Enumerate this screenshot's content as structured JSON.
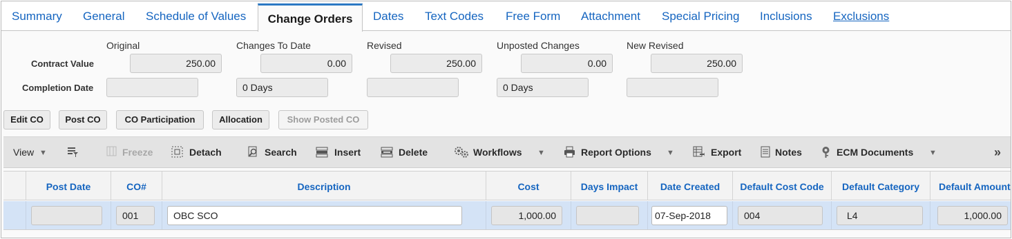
{
  "tabs": [
    {
      "label": "Summary"
    },
    {
      "label": "General"
    },
    {
      "label": "Schedule of Values"
    },
    {
      "label": "Change Orders"
    },
    {
      "label": "Dates"
    },
    {
      "label": "Text Codes"
    },
    {
      "label": "Free Form"
    },
    {
      "label": "Attachment"
    },
    {
      "label": "Special Pricing"
    },
    {
      "label": "Inclusions"
    },
    {
      "label": "Exclusions"
    }
  ],
  "active_tab": "Change Orders",
  "summary": {
    "columns": [
      "Original",
      "Changes To Date",
      "Revised",
      "Unposted Changes",
      "New Revised"
    ],
    "contract_value": {
      "label": "Contract Value",
      "original": "250.00",
      "changes_to_date": "0.00",
      "revised": "250.00",
      "unposted_changes": "0.00",
      "new_revised": "250.00"
    },
    "completion_date": {
      "label": "Completion Date",
      "original": "",
      "changes_to_date": "0  Days",
      "revised": "",
      "unposted_changes": "0  Days",
      "new_revised": ""
    }
  },
  "actions": {
    "edit_co": "Edit CO",
    "post_co": "Post CO",
    "co_participation": "CO Participation",
    "allocation": "Allocation",
    "show_posted_co": "Show Posted CO"
  },
  "toolbar": {
    "view": "View",
    "freeze": "Freeze",
    "detach": "Detach",
    "search": "Search",
    "insert": "Insert",
    "delete": "Delete",
    "workflows": "Workflows",
    "report_options": "Report Options",
    "export": "Export",
    "notes": "Notes",
    "ecm_documents": "ECM Documents"
  },
  "grid": {
    "headers": {
      "post_date": "Post Date",
      "co_num": "CO#",
      "description": "Description",
      "cost": "Cost",
      "days_impact": "Days Impact",
      "date_created": "Date Created",
      "default_cost_code": "Default Cost Code",
      "default_category": "Default Category",
      "default_amount": "Default Amount"
    },
    "rows": [
      {
        "post_date": "",
        "co_num": "001",
        "description": "OBC SCO",
        "cost": "1,000.00",
        "days_impact": "",
        "date_created": "07-Sep-2018",
        "default_cost_code": "004",
        "default_category": "L4",
        "default_amount": "1,000.00"
      }
    ]
  },
  "colors": {
    "link_blue": "#1565c0",
    "active_tab_accent": "#2b78c4",
    "selected_row": "#d4e3f6",
    "toolbar_bg": "#e3e3e3"
  }
}
